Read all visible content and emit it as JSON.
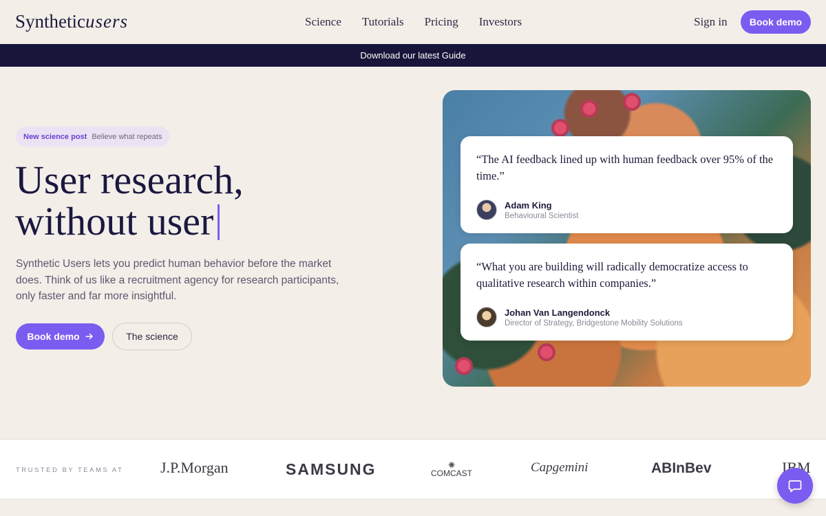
{
  "header": {
    "logo_main": "Synthetic",
    "logo_script": "users",
    "nav": [
      "Science",
      "Tutorials",
      "Pricing",
      "Investors"
    ],
    "signin_label": "Sign in",
    "book_demo_label": "Book demo"
  },
  "banner": {
    "text": "Download our latest Guide"
  },
  "hero": {
    "pill_tag": "New science post",
    "pill_text": "Believe what repeats",
    "headline_line1": "User research,",
    "headline_line2": "without user",
    "description": "Synthetic Users lets you predict human behavior before the market does. Think of us like a recruitment agency for research participants, only faster and far more insightful.",
    "primary_button": "Book demo",
    "secondary_button": "The science"
  },
  "testimonials": [
    {
      "quote": "“The AI feedback lined up with human feedback over 95% of the time.”",
      "name": "Adam King",
      "role": "Behavioural Scientist"
    },
    {
      "quote": "“What you are building will radically democratize access to qualitative research within companies.”",
      "name": "Johan Van Langendonck",
      "role": "Director of Strategy, Bridgestone Mobility Solutions"
    }
  ],
  "trusted": {
    "label": "TRUSTED BY TEAMS AT",
    "logos": [
      "J.P.Morgan",
      "SAMSUNG",
      "COMCAST",
      "Capgemini",
      "ABInBev",
      "IBM"
    ]
  },
  "colors": {
    "accent": "#7b5cf0",
    "banner": "#17163a",
    "background": "#f3eee8"
  }
}
